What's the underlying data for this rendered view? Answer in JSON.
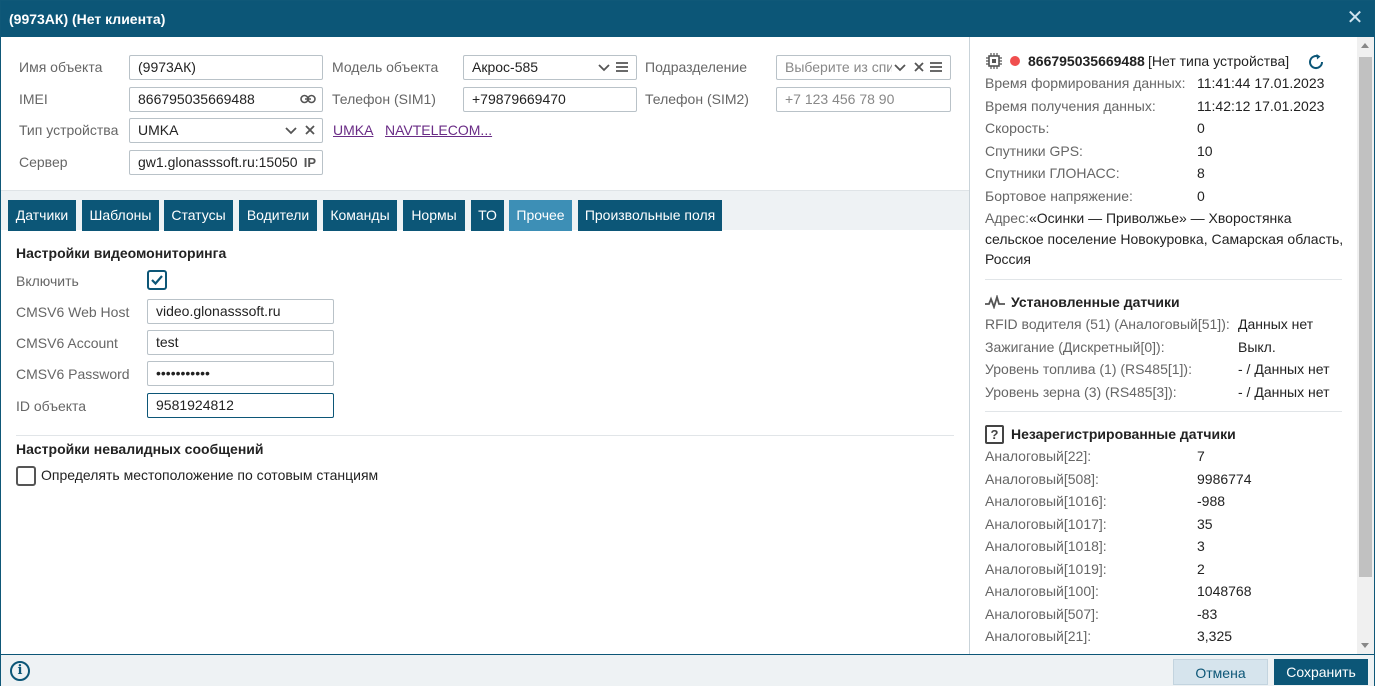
{
  "window": {
    "title": "(9973АК) (Нет клиента)",
    "close_glyph": "✕"
  },
  "form": {
    "object_name": {
      "label": "Имя объекта",
      "value": "(9973АК)"
    },
    "object_model": {
      "label": "Модель объекта",
      "value": "Акрос-585"
    },
    "division": {
      "label": "Подразделение",
      "placeholder": "Выберите из спи"
    },
    "imei": {
      "label": "IMEI",
      "value": "866795035669488"
    },
    "phone1": {
      "label": "Телефон (SIM1)",
      "value": "+79879669470"
    },
    "phone2": {
      "label": "Телефон (SIM2)",
      "placeholder": "+7 123 456 78 90"
    },
    "device_type": {
      "label": "Тип устройства",
      "value": "UMKA"
    },
    "links": [
      "UMKA",
      "NAVTELECOM..."
    ],
    "server": {
      "label": "Сервер",
      "value": "gw1.glonasssoft.ru:15050",
      "badge": "IP"
    }
  },
  "tabs": [
    {
      "label": "Датчики",
      "active": false
    },
    {
      "label": "Шаблоны",
      "active": false
    },
    {
      "label": "Статусы",
      "active": false
    },
    {
      "label": "Водители",
      "active": false
    },
    {
      "label": "Команды",
      "active": false
    },
    {
      "label": "Нормы",
      "active": false
    },
    {
      "label": "ТО",
      "active": false
    },
    {
      "label": "Прочее",
      "active": true
    },
    {
      "label": "Произвольные поля",
      "active": false
    }
  ],
  "video": {
    "title": "Настройки видеомониторинга",
    "enable_label": "Включить",
    "enabled": true,
    "host_label": "CMSV6 Web Host",
    "host_value": "video.glonasssoft.ru",
    "account_label": "CMSV6 Account",
    "account_value": "test",
    "password_label": "CMSV6 Password",
    "password_value": "•••••••••••",
    "id_label": "ID объекта",
    "id_value": "9581924812"
  },
  "invalid": {
    "title": "Настройки невалидных сообщений",
    "cell_label": "Определять местоположение по сотовым станциям",
    "cell_checked": false
  },
  "device": {
    "imei": "866795035669488",
    "type": "[Нет типа устройства]",
    "status_color": "#f04e4e",
    "rows": [
      {
        "label": "Время формирования данных:",
        "value": "11:41:44 17.01.2023"
      },
      {
        "label": "Время получения данных:",
        "value": "11:42:12 17.01.2023"
      },
      {
        "label": "Скорость:",
        "value": "0"
      },
      {
        "label": "Спутники GPS:",
        "value": "10"
      },
      {
        "label": "Спутники ГЛОНАСС:",
        "value": "8"
      },
      {
        "label": "Бортовое напряжение:",
        "value": "0"
      }
    ],
    "address_label": "Адрес:",
    "address_line1": "«Осинки — Приволжье» — Хворостянка",
    "address_line2": "сельское поселение Новокуровка, Самарская область,",
    "address_line3": "Россия"
  },
  "installed": {
    "title": "Установленные датчики",
    "rows": [
      {
        "label": "RFID водителя (51) (Аналоговый[51]):",
        "value": "Данных нет"
      },
      {
        "label": "Зажигание (Дискретный[0]):",
        "value": "Выкл."
      },
      {
        "label": "Уровень топлива (1) (RS485[1]):",
        "value": "- / Данных нет"
      },
      {
        "label": "Уровень зерна (3) (RS485[3]):",
        "value": "- / Данных нет"
      }
    ]
  },
  "unregistered": {
    "title": "Незарегистрированные датчики",
    "rows": [
      {
        "label": "Аналоговый[22]:",
        "value": "7"
      },
      {
        "label": "Аналоговый[508]:",
        "value": "9986774"
      },
      {
        "label": "Аналоговый[1016]:",
        "value": "-988"
      },
      {
        "label": "Аналоговый[1017]:",
        "value": "35"
      },
      {
        "label": "Аналоговый[1018]:",
        "value": "3"
      },
      {
        "label": "Аналоговый[1019]:",
        "value": "2"
      },
      {
        "label": "Аналоговый[100]:",
        "value": "1048768"
      },
      {
        "label": "Аналоговый[507]:",
        "value": "-83"
      },
      {
        "label": "Аналоговый[21]:",
        "value": "3,325"
      }
    ]
  },
  "footer": {
    "info_glyph": "i",
    "cancel_label": "Отмена",
    "save_label": "Сохранить"
  },
  "colors": {
    "primary": "#0c5677",
    "active_tab": "#3d8fb6",
    "link": "#6a2c86"
  }
}
